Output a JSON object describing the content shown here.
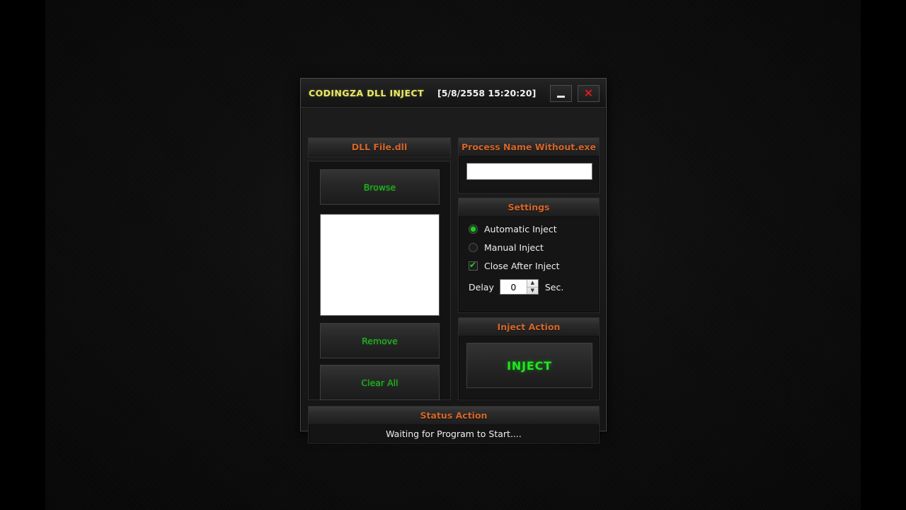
{
  "window": {
    "title": "CODINGZA DLL INJECT",
    "clock": "[5/8/2558 15:20:20]",
    "minimize_label": "",
    "close_label": "✕"
  },
  "dll_panel": {
    "header": "DLL File.dll",
    "browse_label": "Browse",
    "remove_label": "Remove",
    "clear_all_label": "Clear All",
    "list_items": []
  },
  "process_panel": {
    "header": "Process Name Without.exe",
    "input_value": "",
    "input_placeholder": ""
  },
  "settings_panel": {
    "header": "Settings",
    "options": [
      {
        "label": "Automatic Inject",
        "type": "radio",
        "checked": true
      },
      {
        "label": "Manual Inject",
        "type": "radio",
        "checked": false
      },
      {
        "label": "Close After Inject",
        "type": "checkbox",
        "checked": true
      }
    ],
    "delay_label": "Delay",
    "delay_value": "0",
    "delay_unit": "Sec.",
    "spin_up": "▲",
    "spin_down": "▼"
  },
  "inject_panel": {
    "header": "Inject Action",
    "button_label": "INJECT"
  },
  "status_panel": {
    "header": "Status Action",
    "message": "Waiting for Program to Start...."
  },
  "colors": {
    "header_orange": "#d4662a",
    "title_yellow": "#e8e86a",
    "button_green": "#22c422",
    "inject_green": "#1ee81e",
    "close_red": "#e02020",
    "window_bg": "#1a1a1a"
  }
}
